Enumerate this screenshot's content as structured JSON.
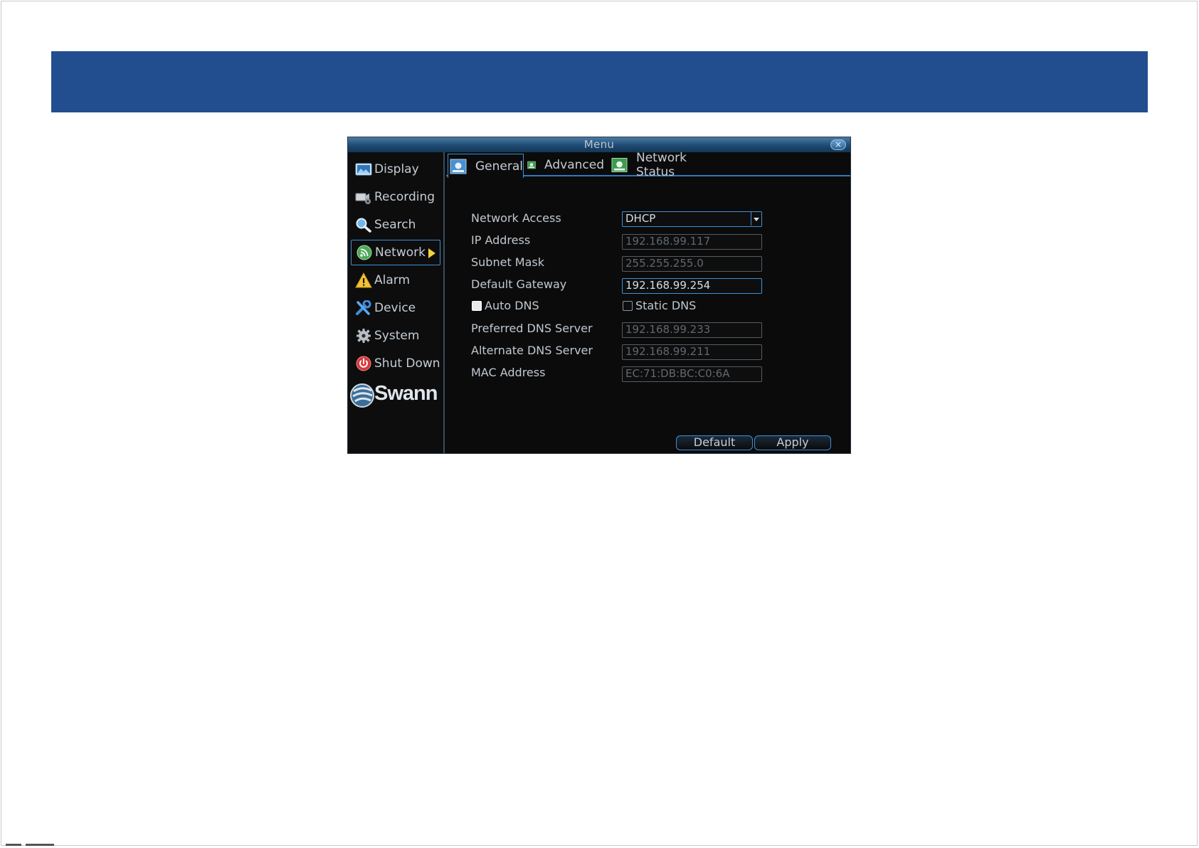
{
  "window": {
    "title": "Menu",
    "close_glyph": "×"
  },
  "sidebar": {
    "items": [
      {
        "label": "Display",
        "icon": "display-icon"
      },
      {
        "label": "Recording",
        "icon": "recording-icon"
      },
      {
        "label": "Search",
        "icon": "search-icon"
      },
      {
        "label": "Network",
        "icon": "network-icon",
        "active": true
      },
      {
        "label": "Alarm",
        "icon": "alarm-icon"
      },
      {
        "label": "Device",
        "icon": "device-icon"
      },
      {
        "label": "System",
        "icon": "system-gear-icon"
      },
      {
        "label": "Shut Down",
        "icon": "power-icon"
      }
    ],
    "logo_text": "Swann"
  },
  "tabs": [
    {
      "label": "General",
      "active": true
    },
    {
      "label": "Advanced"
    },
    {
      "label": "Network Status"
    }
  ],
  "form": {
    "network_access": {
      "label": "Network Access",
      "value": "DHCP"
    },
    "ip_address": {
      "label": "IP Address",
      "value": "192.168.99.117"
    },
    "subnet_mask": {
      "label": "Subnet Mask",
      "value": "255.255.255.0"
    },
    "default_gateway": {
      "label": "Default Gateway",
      "value": "192.168.99.254"
    },
    "auto_dns": {
      "label": "Auto DNS",
      "checked": true
    },
    "static_dns": {
      "label": "Static DNS",
      "checked": false
    },
    "preferred_dns": {
      "label": "Preferred DNS Server",
      "value": "192.168.99.233"
    },
    "alternate_dns": {
      "label": "Alternate DNS Server",
      "value": "192.168.99.211"
    },
    "mac_address": {
      "label": "MAC Address",
      "value": "EC:71:DB:BC:C0:6A"
    }
  },
  "buttons": {
    "default_label": "Default",
    "apply_label": "Apply"
  },
  "colors": {
    "banner": "#224e8f",
    "accent": "#3f8fd6",
    "window_bg": "#0b0b0b",
    "arrow_yellow": "#f2d43a"
  }
}
